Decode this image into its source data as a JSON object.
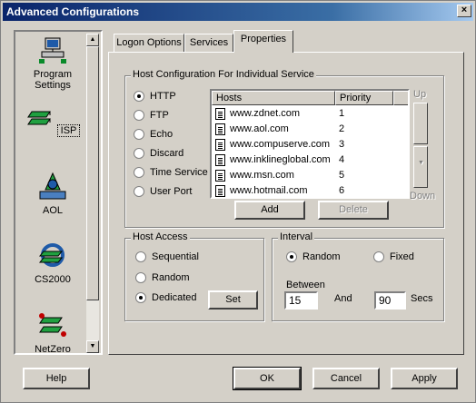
{
  "window": {
    "title": "Advanced Configurations",
    "close_glyph": "×"
  },
  "sidebar": {
    "items": [
      {
        "label": "Program Settings",
        "icon": "computer-network-icon"
      },
      {
        "label": "ISP",
        "icon": "isp-stack-icon"
      },
      {
        "label": "AOL",
        "icon": "aol-icon"
      },
      {
        "label": "CS2000",
        "icon": "cs2000-icon"
      },
      {
        "label": "NetZero",
        "icon": "netzero-icon"
      }
    ],
    "selected": "ISP"
  },
  "tabs": [
    {
      "label": "Logon Options"
    },
    {
      "label": "Services"
    },
    {
      "label": "Properties"
    }
  ],
  "active_tab": "Properties",
  "host_config": {
    "title": "Host Configuration For Individual Service",
    "services": [
      "HTTP",
      "FTP",
      "Echo",
      "Discard",
      "Time Service",
      "User Port"
    ],
    "selected_service": "HTTP",
    "columns": [
      "Hosts",
      "Priority"
    ],
    "rows": [
      {
        "host": "www.zdnet.com",
        "priority": "1"
      },
      {
        "host": "www.aol.com",
        "priority": "2"
      },
      {
        "host": "www.compuserve.com",
        "priority": "3"
      },
      {
        "host": "www.inklineglobal.com",
        "priority": "4"
      },
      {
        "host": "www.msn.com",
        "priority": "5"
      },
      {
        "host": "www.hotmail.com",
        "priority": "6"
      }
    ],
    "up_label": "Up",
    "down_label": "Down",
    "add_label": "Add",
    "delete_label": "Delete"
  },
  "host_access": {
    "title": "Host Access",
    "options": [
      "Sequential",
      "Random",
      "Dedicated"
    ],
    "selected": "Dedicated",
    "set_label": "Set"
  },
  "interval": {
    "title": "Interval",
    "options": [
      "Random",
      "Fixed"
    ],
    "selected": "Random",
    "between_label": "Between",
    "and_label": "And",
    "secs_label": "Secs",
    "from_value": "15",
    "to_value": "90"
  },
  "footer": {
    "help": "Help",
    "ok": "OK",
    "cancel": "Cancel",
    "apply": "Apply"
  }
}
